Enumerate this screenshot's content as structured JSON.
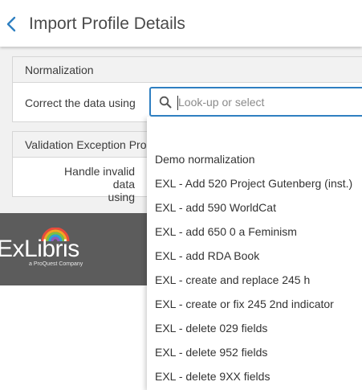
{
  "header": {
    "title": "Import Profile Details"
  },
  "sections": {
    "normalization": {
      "title": "Normalization",
      "field_label": "Correct the data using"
    },
    "validation": {
      "title": "Validation Exception Pro",
      "field_label_line1": "Handle invalid data",
      "field_label_line2": "using"
    }
  },
  "search": {
    "placeholder": "Look-up or select",
    "value": ""
  },
  "dropdown": {
    "options": [
      "Demo normalization",
      "EXL - Add 520 Project Gutenberg (inst.)",
      "EXL - add 590 WorldCat",
      "EXL - add 650 0 a Feminism",
      "EXL - add RDA Book",
      "EXL - create and replace 245 h",
      "EXL - create or fix 245 2nd indicator",
      "EXL - delete 029 fields",
      "EXL - delete 952 fields",
      "EXL - delete 9XX fields"
    ]
  },
  "footer": {
    "logo_text": "ExLibris",
    "logo_sub": "a ProQuest Company"
  },
  "colors": {
    "accent": "#2f7fc1",
    "footer_bg": "#5c5c5c",
    "section_head_bg": "#f2f2f2"
  },
  "icons": {
    "back": "chevron-left-icon",
    "search": "search-icon"
  }
}
